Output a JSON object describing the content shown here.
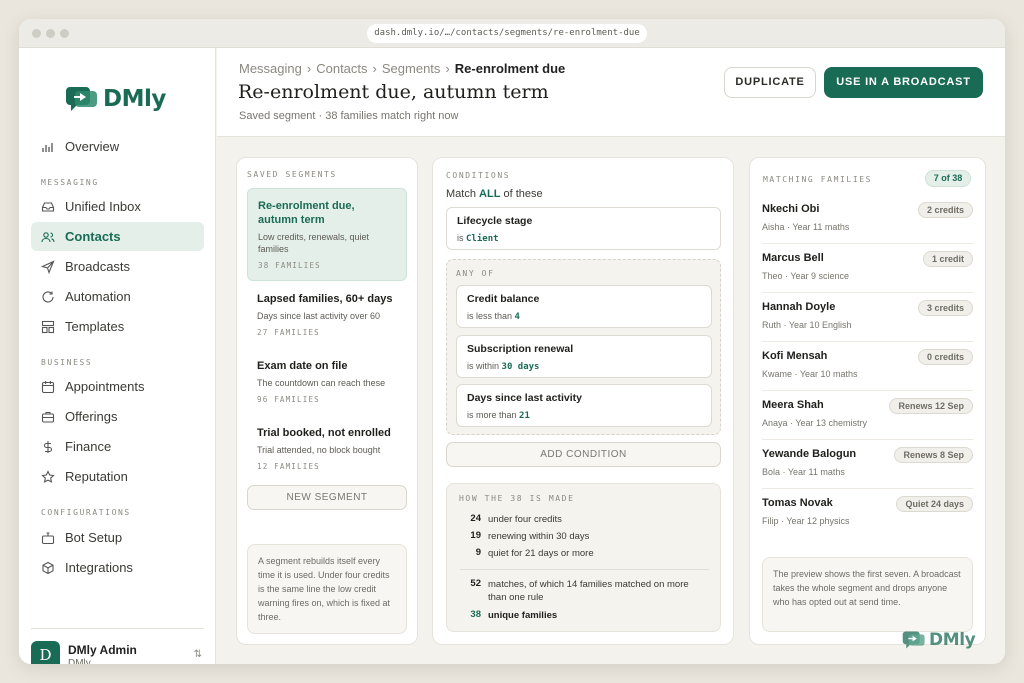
{
  "browser": {
    "url": "dash.dmly.io/…/contacts/segments/re-enrolment-due"
  },
  "brand": {
    "name": "DMly",
    "accent": "#1a6b55"
  },
  "sidebar": {
    "top_item": {
      "label": "Overview",
      "icon": "chart-bar-icon"
    },
    "sections": [
      {
        "title": "MESSAGING",
        "items": [
          {
            "label": "Unified Inbox",
            "icon": "inbox-icon",
            "active": false
          },
          {
            "label": "Contacts",
            "icon": "users-icon",
            "active": true
          },
          {
            "label": "Broadcasts",
            "icon": "send-icon",
            "active": false
          },
          {
            "label": "Automation",
            "icon": "refresh-icon",
            "active": false
          },
          {
            "label": "Templates",
            "icon": "layout-icon",
            "active": false
          }
        ]
      },
      {
        "title": "BUSINESS",
        "items": [
          {
            "label": "Appointments",
            "icon": "calendar-icon",
            "active": false
          },
          {
            "label": "Offerings",
            "icon": "briefcase-icon",
            "active": false
          },
          {
            "label": "Finance",
            "icon": "dollar-icon",
            "active": false
          },
          {
            "label": "Reputation",
            "icon": "star-icon",
            "active": false
          }
        ]
      },
      {
        "title": "CONFIGURATIONS",
        "items": [
          {
            "label": "Bot Setup",
            "icon": "bot-icon",
            "active": false
          },
          {
            "label": "Integrations",
            "icon": "cube-icon",
            "active": false
          }
        ]
      }
    ],
    "user": {
      "initial": "D",
      "name": "DMly Admin",
      "role": "DMly"
    }
  },
  "header": {
    "breadcrumb": [
      "Messaging",
      "Contacts",
      "Segments"
    ],
    "breadcrumb_current": "Re-enrolment due",
    "title": "Re-enrolment due, autumn term",
    "subtitle": "Saved segment · 38 families match right now",
    "duplicate_label": "DUPLICATE",
    "use_label": "USE IN A BROADCAST"
  },
  "saved_segments": {
    "label": "SAVED SEGMENTS",
    "items": [
      {
        "title": "Re-enrolment due, autumn term",
        "desc": "Low credits, renewals, quiet families",
        "count": "38 FAMILIES",
        "active": true
      },
      {
        "title": "Lapsed families, 60+ days",
        "desc": "Days since last activity over 60",
        "count": "27 FAMILIES",
        "active": false
      },
      {
        "title": "Exam date on file",
        "desc": "The countdown can reach these",
        "count": "96 FAMILIES",
        "active": false
      },
      {
        "title": "Trial booked, not enrolled",
        "desc": "Trial attended, no block bought",
        "count": "12 FAMILIES",
        "active": false
      }
    ],
    "new_label": "NEW SEGMENT",
    "note": "A segment rebuilds itself every time it is used. Under four credits is the same line the low credit warning fires on, which is fixed at three."
  },
  "conditions": {
    "label": "CONDITIONS",
    "match_prefix": "Match",
    "match_word": "ALL",
    "match_suffix": "of these",
    "main": {
      "title": "Lifecycle stage",
      "op": "is",
      "value": "Client"
    },
    "any_of_label": "ANY OF",
    "any_of": [
      {
        "title": "Credit balance",
        "op": "is less than",
        "value": "4"
      },
      {
        "title": "Subscription renewal",
        "op": "is within",
        "value": "30 days"
      },
      {
        "title": "Days since last activity",
        "op": "is more than",
        "value": "21"
      }
    ],
    "add_label": "ADD CONDITION",
    "breakdown_label": "HOW THE 38 IS MADE",
    "breakdown": [
      {
        "num": "24",
        "text": "under four credits"
      },
      {
        "num": "19",
        "text": "renewing within 30 days"
      },
      {
        "num": "9",
        "text": "quiet for 21 days or more"
      }
    ],
    "matches": {
      "num": "52",
      "text": "matches, of which 14 families matched on more than one rule"
    },
    "unique": {
      "num": "38",
      "text": "unique families"
    }
  },
  "matching": {
    "label": "MATCHING FAMILIES",
    "count": "7 of 38",
    "families": [
      {
        "name": "Nkechi Obi",
        "sub": "Aisha · Year 11 maths",
        "badge": "2 credits"
      },
      {
        "name": "Marcus Bell",
        "sub": "Theo · Year 9 science",
        "badge": "1 credit"
      },
      {
        "name": "Hannah Doyle",
        "sub": "Ruth · Year 10 English",
        "badge": "3 credits"
      },
      {
        "name": "Kofi Mensah",
        "sub": "Kwame · Year 10 maths",
        "badge": "0 credits"
      },
      {
        "name": "Meera Shah",
        "sub": "Anaya · Year 13 chemistry",
        "badge": "Renews 12 Sep"
      },
      {
        "name": "Yewande Balogun",
        "sub": "Bola · Year 11 maths",
        "badge": "Renews 8 Sep"
      },
      {
        "name": "Tomas Novak",
        "sub": "Filip · Year 12 physics",
        "badge": "Quiet 24 days"
      }
    ],
    "note": "The preview shows the first seven. A broadcast takes the whole segment and drops anyone who has opted out at send time."
  }
}
